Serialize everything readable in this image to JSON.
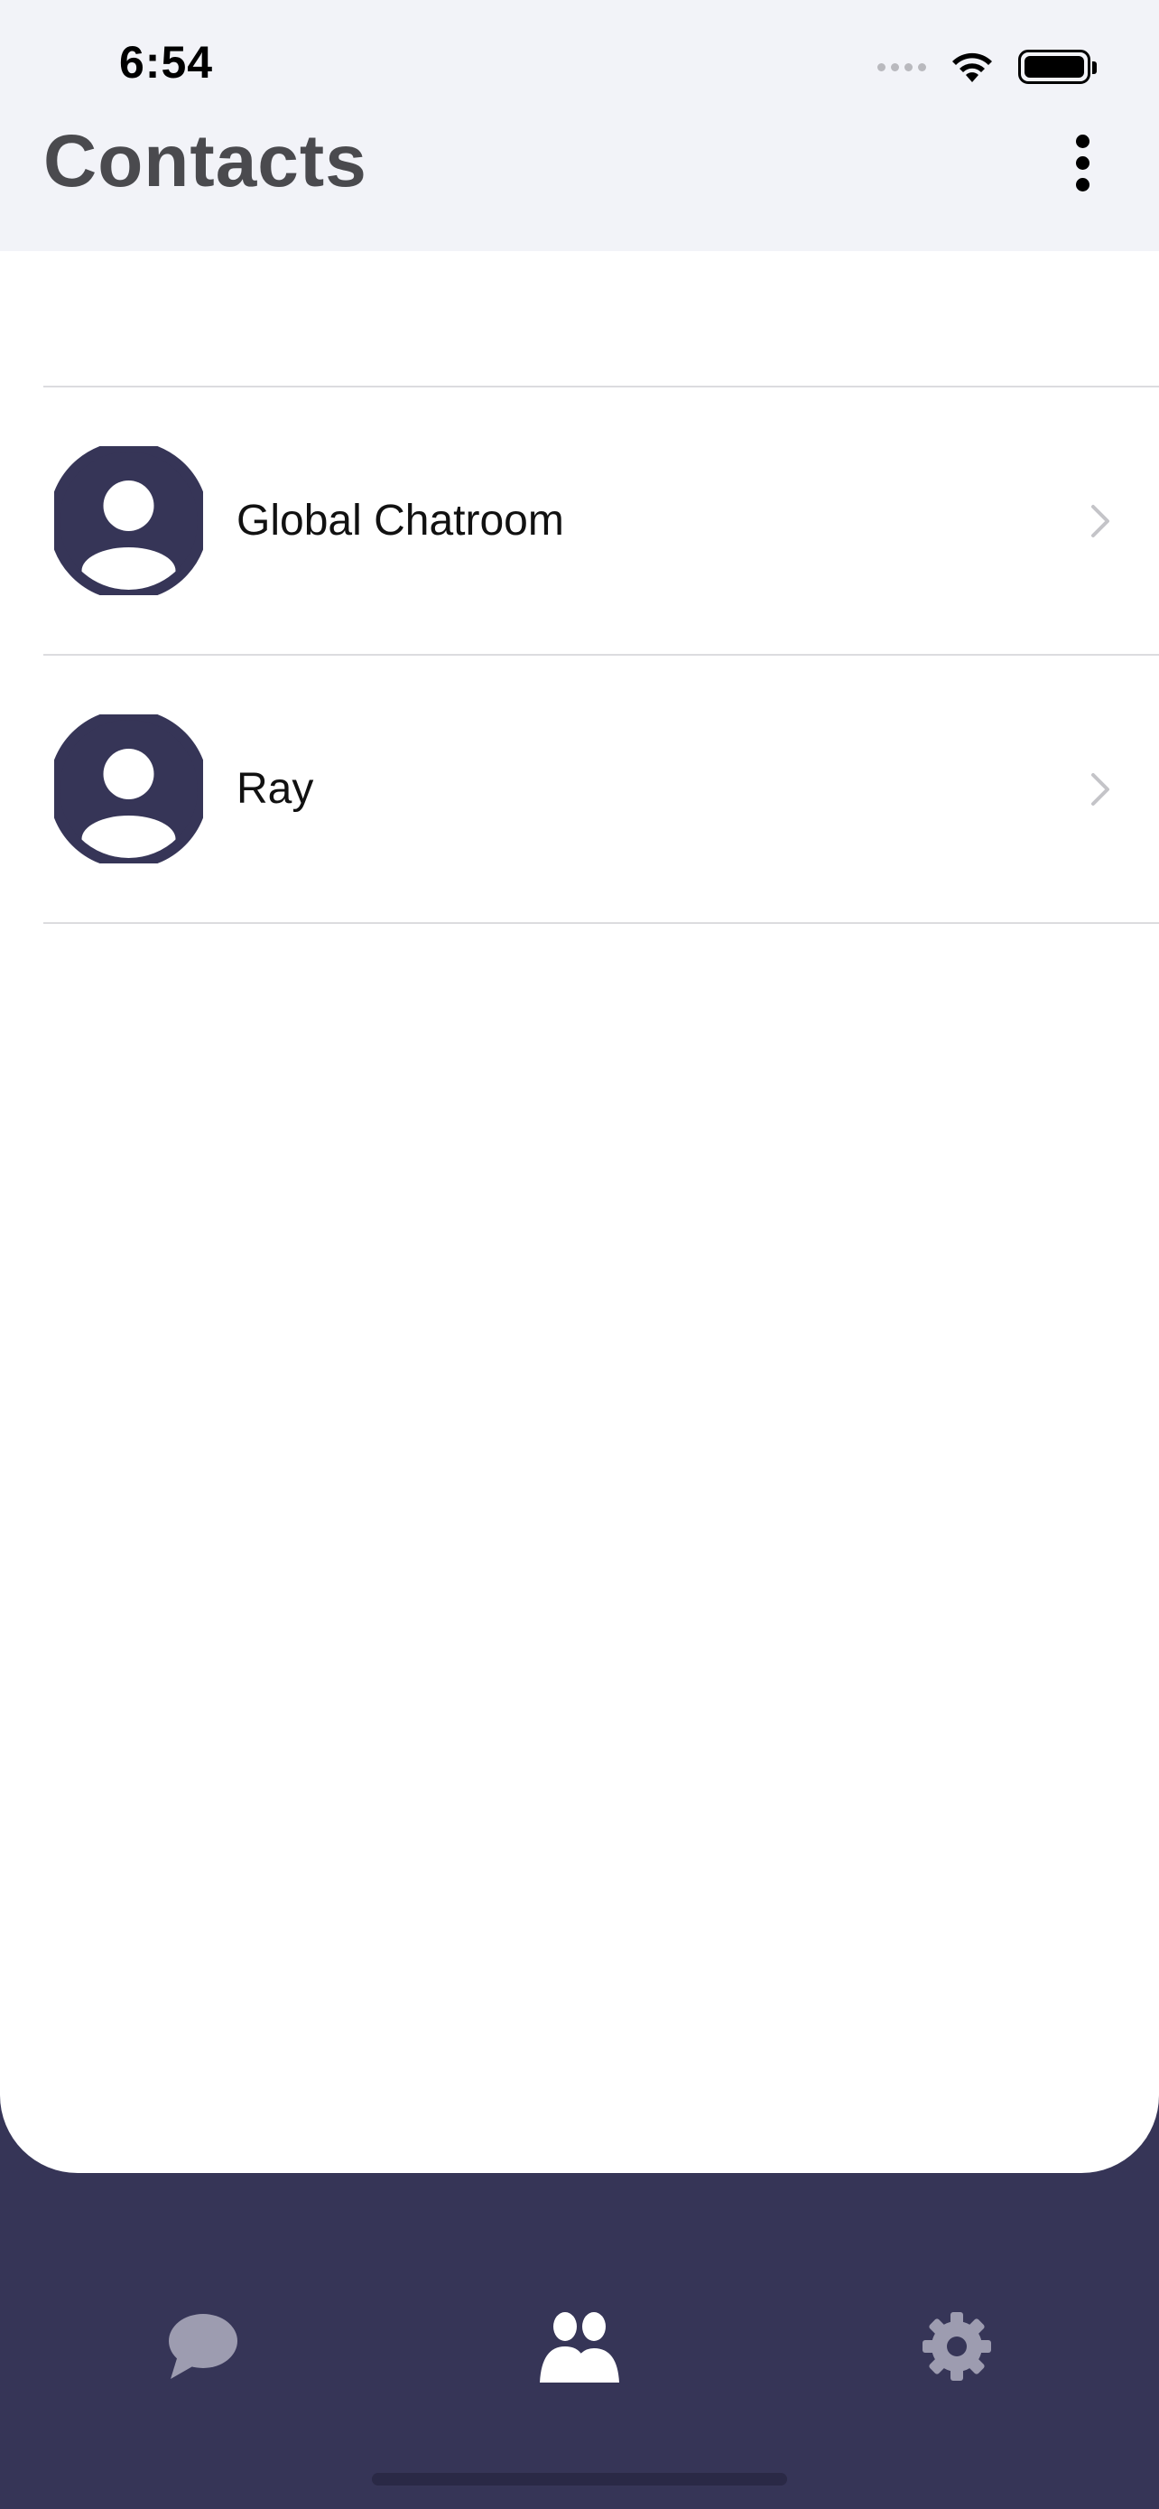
{
  "status_bar": {
    "time": "6:54"
  },
  "header": {
    "title": "Contacts",
    "menu_icon": "more-vertical-icon"
  },
  "contacts": [
    {
      "name": "Global Chatroom",
      "avatar_icon": "person-avatar-icon"
    },
    {
      "name": "Ray",
      "avatar_icon": "person-avatar-icon"
    }
  ],
  "tab_bar": {
    "tabs": [
      {
        "id": "chats",
        "icon": "chat-bubble-icon",
        "active": false
      },
      {
        "id": "contacts",
        "icon": "people-icon",
        "active": true
      },
      {
        "id": "settings",
        "icon": "gear-icon",
        "active": false
      }
    ]
  },
  "colors": {
    "header_bg": "#f2f3f8",
    "accent_navy": "#363557",
    "tab_active": "#ffffff",
    "tab_inactive": "#9d9cb0"
  }
}
